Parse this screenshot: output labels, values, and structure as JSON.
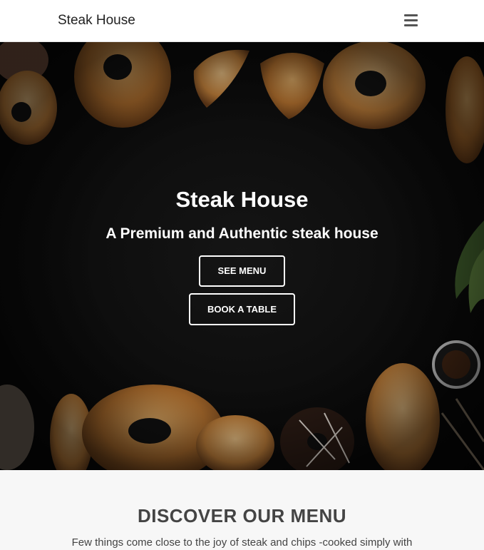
{
  "navbar": {
    "brand": "Steak House",
    "menu_icon": "hamburger-menu-icon"
  },
  "hero": {
    "title": "Steak House",
    "subtitle": "A Premium and Authentic steak house",
    "see_menu_label": "SEE MENU",
    "book_table_label": "BOOK A TABLE",
    "background_image": "baked goods on dark background"
  },
  "menu_section": {
    "heading": "DISCOVER OUR MENU",
    "intro": "Few things come close to the joy of steak and chips -cooked simply with"
  },
  "colors": {
    "hero_background": "#0c0c0c",
    "button_border": "#ffffff",
    "section_background": "#f7f7f7",
    "heading_color": "#444444"
  }
}
